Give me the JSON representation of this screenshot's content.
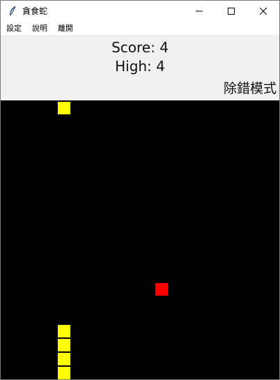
{
  "window": {
    "title": "貪食蛇",
    "icon": "feather-icon",
    "controls": [
      "minimize-icon",
      "maximize-icon",
      "close-icon"
    ]
  },
  "menu": {
    "items": [
      "設定",
      "說明",
      "離開"
    ]
  },
  "scoreboard": {
    "score_text": "Score: 4",
    "high_text": "High: 4",
    "mode_text": "除錯模式"
  },
  "game": {
    "grid_cols": 20,
    "grid_rows": 20,
    "background_color": "#000000",
    "snake_color": "#ffff00",
    "food_color": "#ff0000",
    "snake": [
      [
        4,
        0
      ],
      [
        4,
        16
      ],
      [
        4,
        17
      ],
      [
        4,
        18
      ],
      [
        4,
        19
      ]
    ],
    "food": [
      11,
      13
    ]
  }
}
